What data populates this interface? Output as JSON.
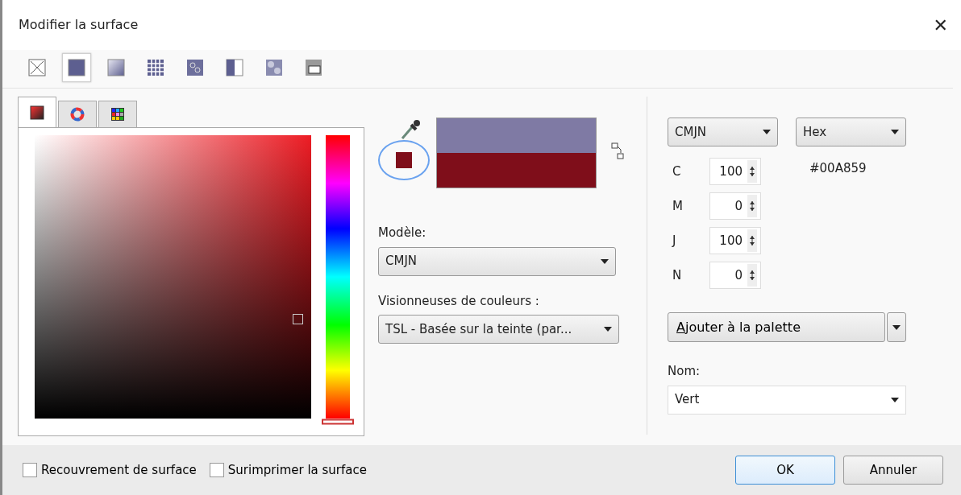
{
  "window": {
    "title": "Modifier la surface",
    "close": "✕"
  },
  "fill_types": [
    {
      "kind": "none",
      "selected": false
    },
    {
      "kind": "uniform",
      "selected": true
    },
    {
      "kind": "fountain",
      "selected": false
    },
    {
      "kind": "vector",
      "selected": false
    },
    {
      "kind": "bitmap",
      "selected": false
    },
    {
      "kind": "twocolor",
      "selected": false
    },
    {
      "kind": "texture",
      "selected": false
    },
    {
      "kind": "postscript",
      "selected": false
    }
  ],
  "picker_tabs": [
    {
      "kind": "square",
      "selected": true
    },
    {
      "kind": "wheel",
      "selected": false
    },
    {
      "kind": "grid",
      "selected": false
    }
  ],
  "hue_slider": {
    "level": 0
  },
  "preview": {
    "swatches": [
      {
        "color": "#7f7aa4"
      },
      {
        "color": "#7f0e1a"
      }
    ],
    "sample": {
      "color": "#7f0e1a"
    }
  },
  "model": {
    "label": "Modèle:",
    "value": "CMJN"
  },
  "viewer": {
    "label": "Visionneuses de couleurs :",
    "value": "TSL - Basée sur la teinte (par..."
  },
  "value_model": "CMJN",
  "hex_format": "Hex",
  "hex_value": "#00A859",
  "components": [
    {
      "label": "C",
      "value": "100"
    },
    {
      "label": "M",
      "value": "0"
    },
    {
      "label": "J",
      "value": "100"
    },
    {
      "label": "N",
      "value": "0"
    }
  ],
  "add_button": "Ajouter à la palette",
  "name": {
    "label": "Nom:",
    "value": "Vert"
  },
  "options": [
    {
      "label": "Recouvrement de surface",
      "checked": false
    },
    {
      "label": "Surimprimer la surface",
      "checked": false
    }
  ],
  "buttons": [
    {
      "label": "OK",
      "default": true
    },
    {
      "label": "Annuler",
      "default": false
    }
  ]
}
